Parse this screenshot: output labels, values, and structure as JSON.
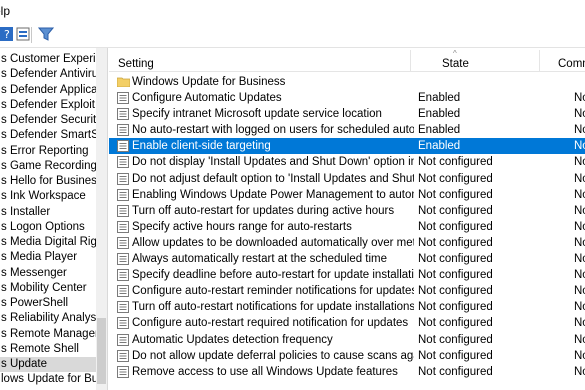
{
  "menubar": {
    "help_label": "elp"
  },
  "toolbar": {
    "buttons": [
      {
        "name": "help-button",
        "icon": "help-icon"
      },
      {
        "name": "view-button",
        "icon": "view-icon"
      },
      {
        "name": "filter-button",
        "icon": "filter-icon"
      }
    ]
  },
  "tree": {
    "items": [
      "s Customer Experienc",
      "s Defender Antivirus",
      "s Defender Applicatio",
      "s Defender Exploit Gu",
      "s Defender Security C",
      "s Defender SmartScre",
      "s Error Reporting",
      "s Game Recording ar",
      "s Hello for Business",
      "s Ink Workspace",
      "s Installer",
      "s Logon Options",
      "s Media Digital Right",
      "s Media Player",
      "s Messenger",
      "s Mobility Center",
      "s PowerShell",
      "s Reliability Analysis",
      "s Remote Manageme",
      "s Remote Shell",
      "s Update",
      "lows Update for Busi"
    ],
    "selected_index": 20
  },
  "list": {
    "columns": {
      "setting": "Setting",
      "state": "State",
      "comment": "Comm"
    },
    "folder": {
      "label": "Windows Update for Business",
      "icon": "folder-icon"
    },
    "rows": [
      {
        "setting": "Configure Automatic Updates",
        "state": "Enabled",
        "comment": "No"
      },
      {
        "setting": "Specify intranet Microsoft update service location",
        "state": "Enabled",
        "comment": "No"
      },
      {
        "setting": "No auto-restart with logged on users for scheduled automat...",
        "state": "Enabled",
        "comment": "No"
      },
      {
        "setting": "Enable client-side targeting",
        "state": "Enabled",
        "comment": "No"
      },
      {
        "setting": "Do not display 'Install Updates and Shut Down' option in Sh...",
        "state": "Not configured",
        "comment": "No"
      },
      {
        "setting": "Do not adjust default option to 'Install Updates and Shut Do...",
        "state": "Not configured",
        "comment": "No"
      },
      {
        "setting": "Enabling Windows Update Power Management to automati...",
        "state": "Not configured",
        "comment": "No"
      },
      {
        "setting": "Turn off auto-restart for updates during active hours",
        "state": "Not configured",
        "comment": "No"
      },
      {
        "setting": "Specify active hours range for auto-restarts",
        "state": "Not configured",
        "comment": "No"
      },
      {
        "setting": "Allow updates to be downloaded automatically over metere...",
        "state": "Not configured",
        "comment": "No"
      },
      {
        "setting": "Always automatically restart at the scheduled time",
        "state": "Not configured",
        "comment": "No"
      },
      {
        "setting": "Specify deadline before auto-restart for update installation",
        "state": "Not configured",
        "comment": "No"
      },
      {
        "setting": "Configure auto-restart reminder notifications for updates",
        "state": "Not configured",
        "comment": "No"
      },
      {
        "setting": "Turn off auto-restart notifications for update installations",
        "state": "Not configured",
        "comment": "No"
      },
      {
        "setting": "Configure auto-restart required notification for updates",
        "state": "Not configured",
        "comment": "No"
      },
      {
        "setting": "Automatic Updates detection frequency",
        "state": "Not configured",
        "comment": "No"
      },
      {
        "setting": "Do not allow update deferral policies to cause scans against ...",
        "state": "Not configured",
        "comment": "No"
      },
      {
        "setting": "Remove access to use all Windows Update features",
        "state": "Not configured",
        "comment": "No"
      }
    ],
    "selected_index": 3
  },
  "colors": {
    "selection": "#0078d7",
    "tree_selection": "#d9d9d9"
  }
}
